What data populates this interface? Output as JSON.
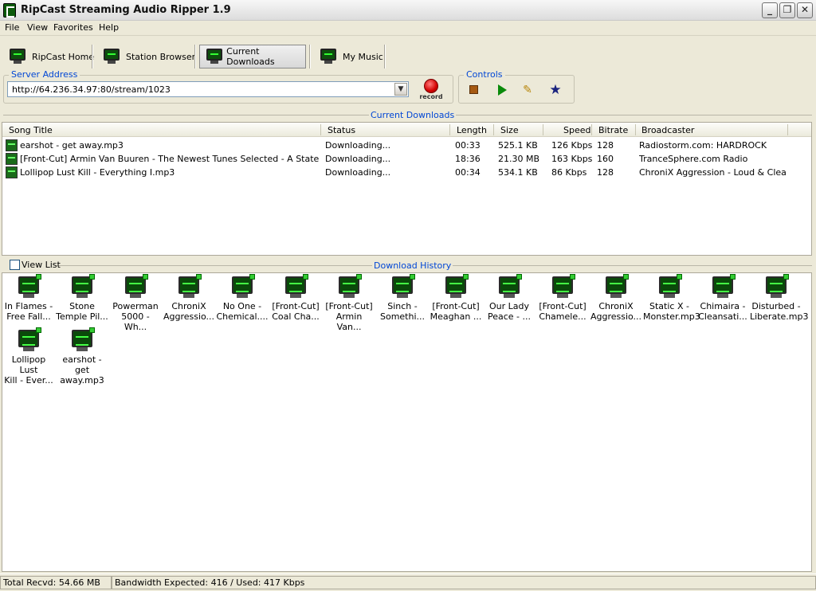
{
  "window": {
    "title": "RipCast Streaming Audio Ripper 1.9",
    "minimize": "_",
    "restore": "❐",
    "close": "✕"
  },
  "menu": [
    "File",
    "View",
    "Favorites",
    "Help"
  ],
  "toolbar": {
    "home": "RipCast Home",
    "browser": "Station Browser",
    "downloads": "Current Downloads",
    "music": "My Music"
  },
  "server": {
    "group_label": "Server Address",
    "address": "http://64.236.34.97:80/stream/1023",
    "record_label": "record"
  },
  "controls": {
    "group_label": "Controls"
  },
  "current_downloads": {
    "section_label": "Current Downloads",
    "columns": [
      "Song Title",
      "Status",
      "Length",
      "Size",
      "Speed",
      "Bitrate",
      "Broadcaster"
    ],
    "rows": [
      {
        "title": "earshot - get away.mp3",
        "status": "Downloading...",
        "length": "00:33",
        "size": "525.1 KB",
        "speed": "126 Kbps",
        "bitrate": "128",
        "broadcaster": "Radiostorm.com: HARDROCK"
      },
      {
        "title": "[Front-Cut] Armin Van Buuren - The Newest Tunes Selected - A State of Tra...",
        "status": "Downloading...",
        "length": "18:36",
        "size": "21.30 MB",
        "speed": "163 Kbps",
        "bitrate": "160",
        "broadcaster": "TranceSphere.com Radio"
      },
      {
        "title": "Lollipop Lust Kill - Everything I.mp3",
        "status": "Downloading...",
        "length": "00:34",
        "size": "534.1 KB",
        "speed": "86 Kbps",
        "bitrate": "128",
        "broadcaster": "ChroniX Aggression - Loud & Clear ..."
      }
    ]
  },
  "history": {
    "view_list_label": "View List",
    "section_label": "Download History",
    "items": [
      {
        "line1": "In Flames -",
        "line2": "Free Fall..."
      },
      {
        "line1": "Stone",
        "line2": "Temple Pil..."
      },
      {
        "line1": "Powerman",
        "line2": "5000 - Wh..."
      },
      {
        "line1": "ChroniX",
        "line2": "Aggressio..."
      },
      {
        "line1": "No One -",
        "line2": "Chemical...."
      },
      {
        "line1": "[Front-Cut]",
        "line2": "Coal Cha..."
      },
      {
        "line1": "[Front-Cut]",
        "line2": "Armin Van..."
      },
      {
        "line1": "Sinch -",
        "line2": "Somethi..."
      },
      {
        "line1": "[Front-Cut]",
        "line2": "Meaghan ..."
      },
      {
        "line1": "Our Lady",
        "line2": "Peace - ..."
      },
      {
        "line1": "[Front-Cut]",
        "line2": "Chamele..."
      },
      {
        "line1": "ChroniX",
        "line2": "Aggressio..."
      },
      {
        "line1": "Static X -",
        "line2": "Monster.mp3"
      },
      {
        "line1": "Chimaira -",
        "line2": "Cleansati..."
      },
      {
        "line1": "Disturbed -",
        "line2": "Liberate.mp3"
      },
      {
        "line1": "Lollipop Lust",
        "line2": "Kill - Ever..."
      },
      {
        "line1": "earshot - get",
        "line2": "away.mp3"
      }
    ]
  },
  "status": {
    "total": "Total Recvd: 54.66 MB",
    "bandwidth": "Bandwidth Expected: 416 / Used: 417 Kbps"
  },
  "colors": {
    "group_label": "#0046d5",
    "record_red": "#d30000",
    "play_green": "#0a8a0a"
  }
}
